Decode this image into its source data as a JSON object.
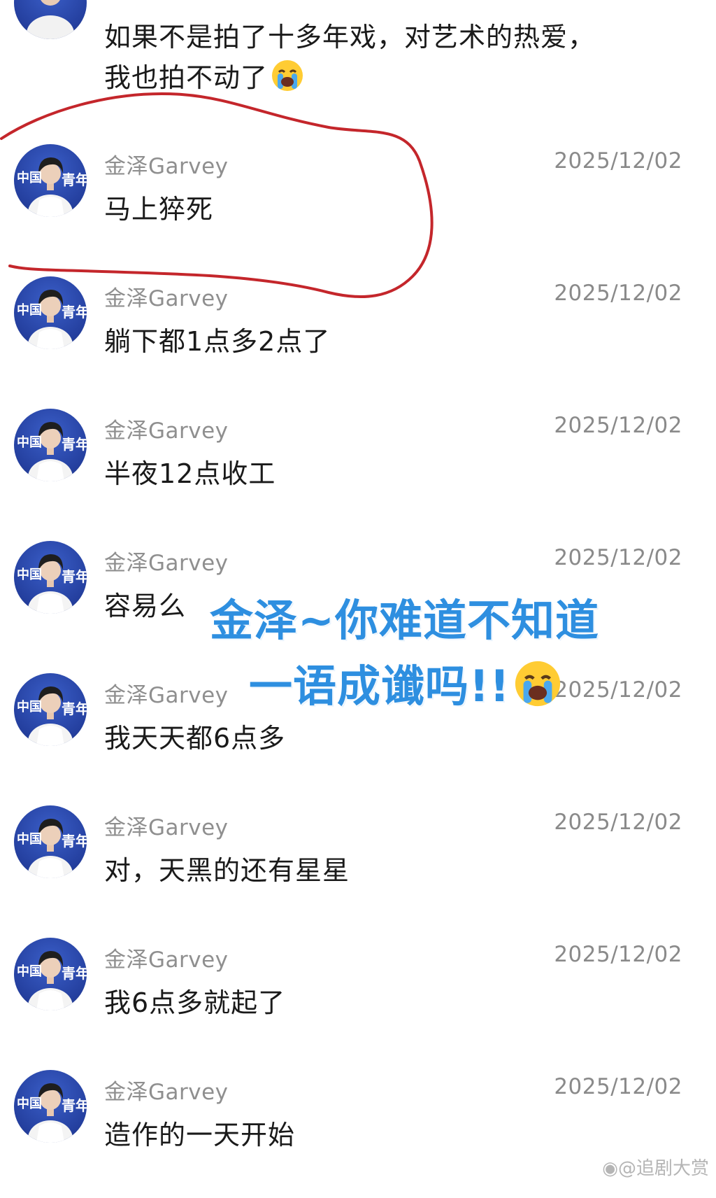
{
  "top_comment": {
    "line1": "如果不是拍了十多年戏，对艺术的热爱，",
    "line2": "我也拍不动了"
  },
  "comments": [
    {
      "username": "金泽Garvey",
      "timestamp": "2025/12/02",
      "text": "马上猝死"
    },
    {
      "username": "金泽Garvey",
      "timestamp": "2025/12/02",
      "text": "躺下都1点多2点了"
    },
    {
      "username": "金泽Garvey",
      "timestamp": "2025/12/02",
      "text": "半夜12点收工"
    },
    {
      "username": "金泽Garvey",
      "timestamp": "2025/12/02",
      "text": "容易么"
    },
    {
      "username": "金泽Garvey",
      "timestamp": "2025/12/02",
      "text": "我天天都6点多"
    },
    {
      "username": "金泽Garvey",
      "timestamp": "2025/12/02",
      "text": "对，天黑的还有星星"
    },
    {
      "username": "金泽Garvey",
      "timestamp": "2025/12/02",
      "text": "我6点多就起了"
    },
    {
      "username": "金泽Garvey",
      "timestamp": "2025/12/02",
      "text": "造作的一天开始"
    }
  ],
  "avatar_badge": {
    "left": "中国",
    "right": "青年"
  },
  "overlay": {
    "line1": "金泽~你难道不知道",
    "line2": "一语成谶吗!!"
  },
  "watermark": "@追剧大赏",
  "colors": {
    "overlay_text": "#2e8fe0",
    "highlight_circle": "#c4262b",
    "username": "#8f8f8f",
    "body_text": "#1a1a1a"
  },
  "icons": {
    "emoji": "loudly-crying-face-icon",
    "watermark_logo": "weibo-icon"
  }
}
